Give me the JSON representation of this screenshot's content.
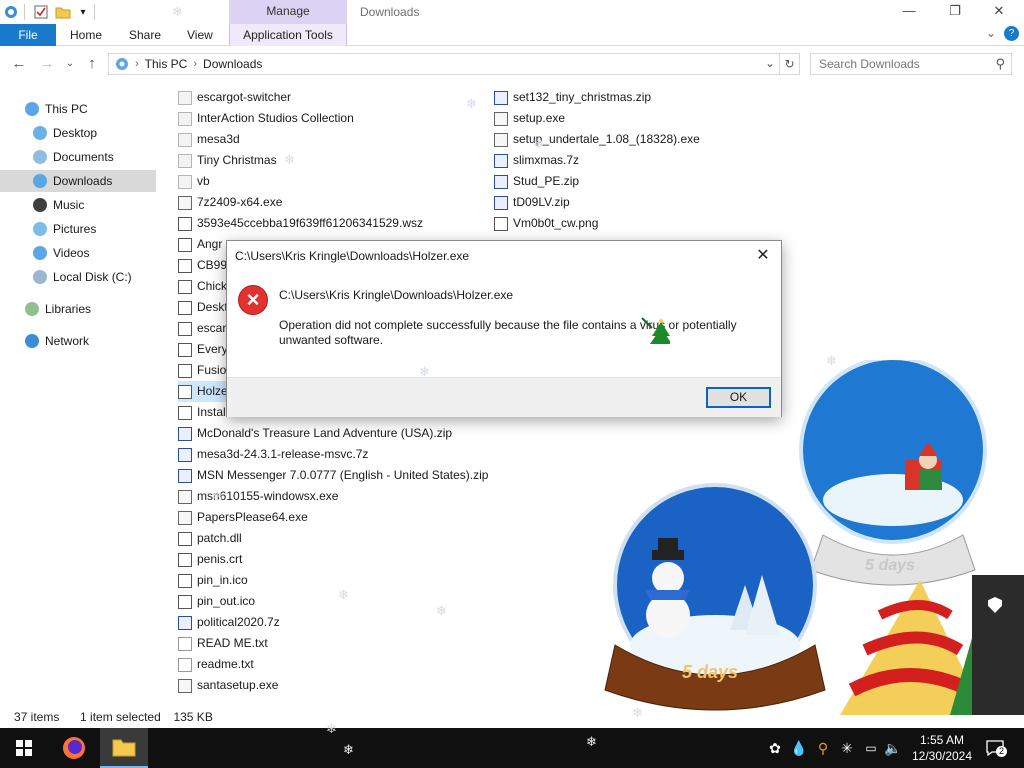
{
  "window": {
    "title": "Downloads",
    "context_tab_header": "Manage",
    "minimize": "—",
    "maximize": "❐",
    "close": "✕"
  },
  "ribbon": {
    "tabs": [
      "File",
      "Home",
      "Share",
      "View",
      "Application Tools"
    ],
    "collapse": "⌄",
    "help": "?"
  },
  "address": {
    "crumbs": [
      "This PC",
      "Downloads"
    ],
    "search_placeholder": "Search Downloads"
  },
  "nav": {
    "items": [
      {
        "label": "This PC",
        "icon": "pc-icon"
      },
      {
        "label": "Desktop",
        "icon": "desktop-icon"
      },
      {
        "label": "Documents",
        "icon": "documents-icon"
      },
      {
        "label": "Downloads",
        "icon": "downloads-icon",
        "selected": true
      },
      {
        "label": "Music",
        "icon": "music-icon"
      },
      {
        "label": "Pictures",
        "icon": "pictures-icon"
      },
      {
        "label": "Videos",
        "icon": "videos-icon"
      },
      {
        "label": "Local Disk (C:)",
        "icon": "disk-icon"
      },
      {
        "label": "Libraries",
        "icon": "libraries-icon"
      },
      {
        "label": "Network",
        "icon": "network-icon"
      }
    ]
  },
  "files_col1": [
    "escargot-switcher",
    "InterAction Studios Collection",
    "mesa3d",
    "Tiny Christmas",
    "vb",
    "7z2409-x64.exe",
    "3593e45ccebba19f639ff61206341529.wsz",
    "Angr",
    "CB99",
    "Chick",
    "Deskt",
    "escarg",
    "Every",
    "Fusion",
    "Holze",
    "Install",
    "McDonald's Treasure Land Adventure (USA).zip",
    "mesa3d-24.3.1-release-msvc.7z",
    "MSN Messenger 7.0.0777 (English - United States).zip",
    "msn610155-windowsx.exe",
    "PapersPlease64.exe",
    "patch.dll",
    "penis.crt",
    "pin_in.ico",
    "pin_out.ico",
    "political2020.7z",
    "READ ME.txt",
    "readme.txt",
    "santasetup.exe"
  ],
  "files_col2": [
    "set132_tiny_christmas.zip",
    "setup.exe",
    "setup_undertale_1.08_(18328).exe",
    "slimxmas.7z",
    "Stud_PE.zip",
    "tD09LV.zip",
    "Vm0b0t_cw.png"
  ],
  "dialog": {
    "title": "C:\\Users\\Kris Kringle\\Downloads\\Holzer.exe",
    "path": "C:\\Users\\Kris Kringle\\Downloads\\Holzer.exe",
    "message": "Operation did not complete successfully because the file contains a virus or potentially unwanted software.",
    "ok_label": "OK"
  },
  "status": {
    "items": "37 items",
    "selected": "1 item selected",
    "size": "135 KB"
  },
  "desktop": {
    "globe1_label": "5 days",
    "globe2_label": "5 days"
  },
  "taskbar": {
    "time": "1:55 AM",
    "date": "12/30/2024",
    "notification_count": "2"
  },
  "colors": {
    "file_tab": "#1979ca",
    "manage_band": "#dcd2f3",
    "selected_nav": "#d9d9d9",
    "error_red": "#e0332f",
    "taskbar": "#101010"
  }
}
